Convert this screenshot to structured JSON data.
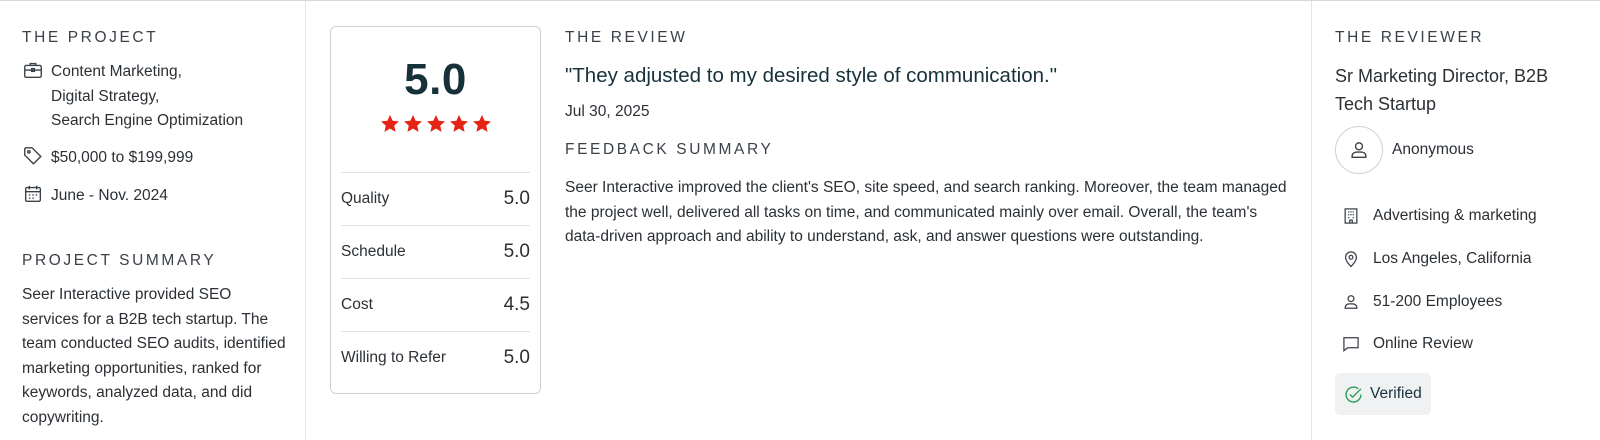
{
  "project": {
    "section_title": "THE PROJECT",
    "services": [
      "Content Marketing,",
      "Digital Strategy,",
      "Search Engine Optimization"
    ],
    "budget": "$50,000 to $199,999",
    "timeline": "June - Nov. 2024",
    "summary_title": "PROJECT SUMMARY",
    "summary": "Seer Interactive provided SEO services for a B2B tech startup. The team conducted SEO audits, identified marketing opportunities, ranked for keywords, analyzed data, and did copywriting.",
    "icons": {
      "services": "briefcase-icon",
      "budget": "tag-icon",
      "timeline": "calendar-icon"
    }
  },
  "rating": {
    "overall": "5.0",
    "stars": 5,
    "star_color": "#e62415",
    "rows": [
      {
        "label": "Quality",
        "value": "5.0"
      },
      {
        "label": "Schedule",
        "value": "5.0"
      },
      {
        "label": "Cost",
        "value": "4.5"
      },
      {
        "label": "Willing to Refer",
        "value": "5.0"
      }
    ]
  },
  "review": {
    "section_title": "THE REVIEW",
    "quote": "\"They adjusted to my desired style of communication.\"",
    "date": "Jul 30, 2025",
    "feedback_title": "FEEDBACK SUMMARY",
    "feedback": "Seer Interactive improved the client's SEO, site speed, and search ranking. Moreover, the team managed the project well, delivered all tasks on time, and communicated mainly over email. Overall, the team's data-driven approach and ability to understand, ask, and answer questions were outstanding."
  },
  "reviewer": {
    "section_title": "THE REVIEWER",
    "role": "Sr Marketing Director, B2B Tech Startup",
    "name": "Anonymous",
    "industry": "Advertising & marketing",
    "location": "Los Angeles, California",
    "size": "51-200 Employees",
    "review_type": "Online Review",
    "verified": "Verified",
    "verified_color": "#2f9e5a",
    "icons": {
      "avatar": "user-icon",
      "industry": "building-icon",
      "location": "location-pin-icon",
      "size": "person-icon",
      "review_type": "chat-bubble-icon",
      "verified": "check-circle-icon"
    }
  }
}
